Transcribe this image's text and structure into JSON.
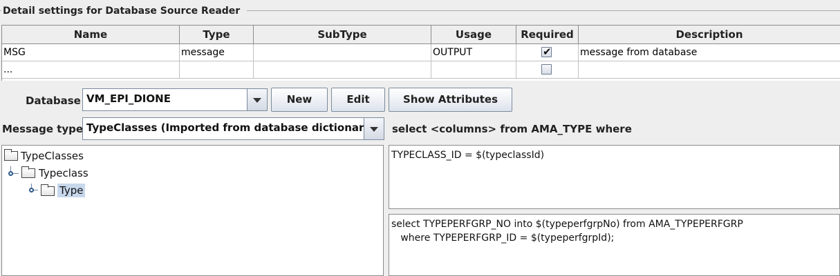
{
  "group": {
    "title": "Detail settings for Database Source Reader"
  },
  "table": {
    "headers": [
      "Name",
      "Type",
      "SubType",
      "Usage",
      "Required",
      "Description"
    ],
    "rows": [
      {
        "name": "MSG",
        "type": "message",
        "subtype": "",
        "usage": "OUTPUT",
        "required": true,
        "required_mark": "✔",
        "description": "message from database"
      },
      {
        "name": "...",
        "type": "",
        "subtype": "",
        "usage": "",
        "required": false,
        "required_mark": "",
        "description": ""
      }
    ]
  },
  "database": {
    "label": "Database",
    "value": "VM_EPI_DIONE"
  },
  "buttons": {
    "new": "New",
    "edit": "Edit",
    "show_attributes": "Show Attributes"
  },
  "message_type": {
    "label": "Message type",
    "value": "TypeClasses (Imported from database dictionary)"
  },
  "sql_hint": "select <columns> from AMA_TYPE where",
  "tree": {
    "nodes": [
      {
        "label": "TypeClasses",
        "selected": false
      },
      {
        "label": "Typeclass",
        "selected": false
      },
      {
        "label": "Type",
        "selected": true
      }
    ]
  },
  "where_clause": "TYPECLASS_ID = $(typeclassId)",
  "sql_statement": "select TYPEPERFGRP_NO into $(typeperfgrpNo) from AMA_TYPEPERFGRP\n   where TYPEPERFGRP_ID = $(typeperfgrpId);",
  "colors": {
    "selection": "#c8d8ec",
    "tree_connector": "#2e5b8a"
  },
  "icons": {
    "folder": "folder-icon",
    "dropdown": "chevron-down-icon",
    "check": "check-icon"
  }
}
